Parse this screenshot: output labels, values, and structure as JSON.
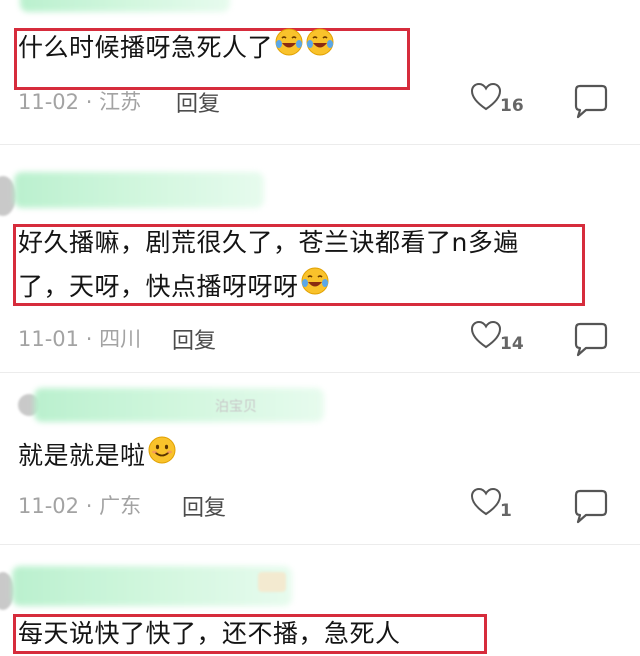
{
  "comments": [
    {
      "text": "什么时候播呀急死人了",
      "emojis": [
        "crying-laughing-emoji",
        "crying-laughing-emoji"
      ],
      "date": "11-02",
      "location": "江苏",
      "reply_label": "回复",
      "likes": "16"
    },
    {
      "text_line1": "好久播嘛，剧荒很久了，苍兰诀都看了n多遍",
      "text_line2": "了，天呀，快点播呀呀呀",
      "emojis": [
        "crying-laughing-emoji"
      ],
      "date": "11-01",
      "location": "四川",
      "reply_label": "回复",
      "likes": "14"
    },
    {
      "username_fragment": "泊宝贝",
      "text": "就是就是啦",
      "emojis": [
        "smiling-face-emoji"
      ],
      "date": "11-02",
      "location": "广东",
      "reply_label": "回复",
      "likes": "1"
    },
    {
      "text_partial": "每天说快了快了，还不播，急死人"
    }
  ],
  "separator": "·",
  "colors": {
    "highlight_box": "#d62c3c",
    "meta_text": "#a3a3a3",
    "redaction": "#b7f0cc"
  }
}
